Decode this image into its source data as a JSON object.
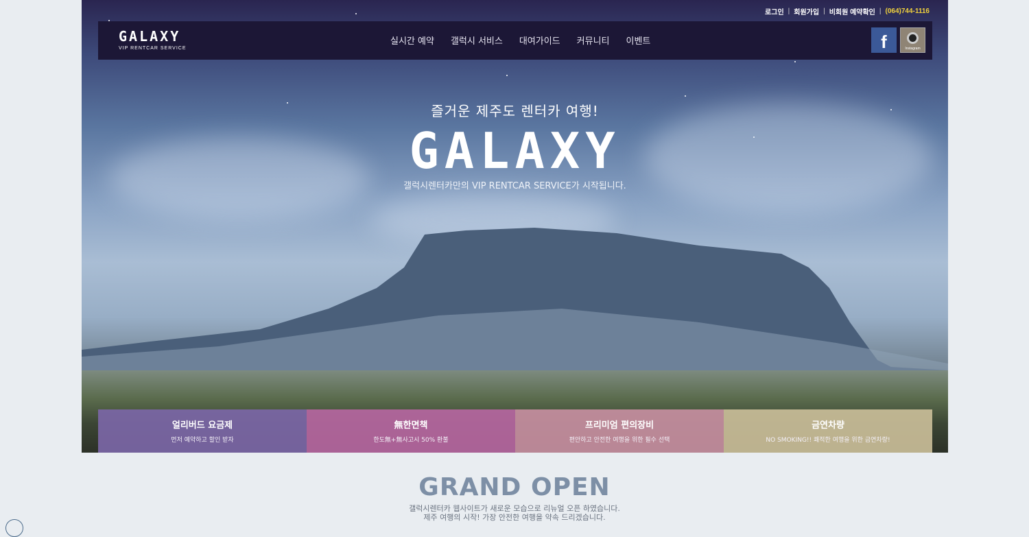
{
  "topbar": {
    "login": "로그인",
    "signup": "회원가입",
    "guest_check": "비회원 예약확인",
    "phone": "(064)744-1116"
  },
  "header": {
    "logo_main": "GALAXY",
    "logo_sub": "VIP RENTCAR SERVICE",
    "menu": [
      "실시간 예약",
      "갤럭시 서비스",
      "대여가이드",
      "커뮤니티",
      "이벤트"
    ],
    "facebook_icon": "facebook-icon",
    "instagram_icon": "instagram-icon",
    "instagram_label": "Instagram"
  },
  "hero": {
    "tagline": "즐거운 제주도 렌터카 여행!",
    "title": "GALAXY",
    "subline": "갤럭시렌터카만의 VIP RENTCAR SERVICE가 시작됩니다."
  },
  "features": [
    {
      "title": "얼리버드 요금제",
      "desc": "먼저 예약하고 할인 받자",
      "color": "#7b66a6"
    },
    {
      "title": "無한면책",
      "desc": "한도無+無사고시 50% 환불",
      "color": "#b566a0"
    },
    {
      "title": "프리미엄 편의장비",
      "desc": "편안하고 안전한 여행을 위한 필수 선택",
      "color": "#c58ea0"
    },
    {
      "title": "금연차량",
      "desc": "NO SMOKING!! 쾌적한 여행을 위한 금연차량!",
      "color": "#c9bd98"
    }
  ],
  "grand_open": {
    "title": "GRAND OPEN",
    "line1": "갤럭시렌터카 웹사이트가 새로운 모습으로 리뉴얼 오픈 하였습니다.",
    "line2": "제주 여행의 시작! 가장 안전한 여행을 약속 드리겠습니다."
  }
}
